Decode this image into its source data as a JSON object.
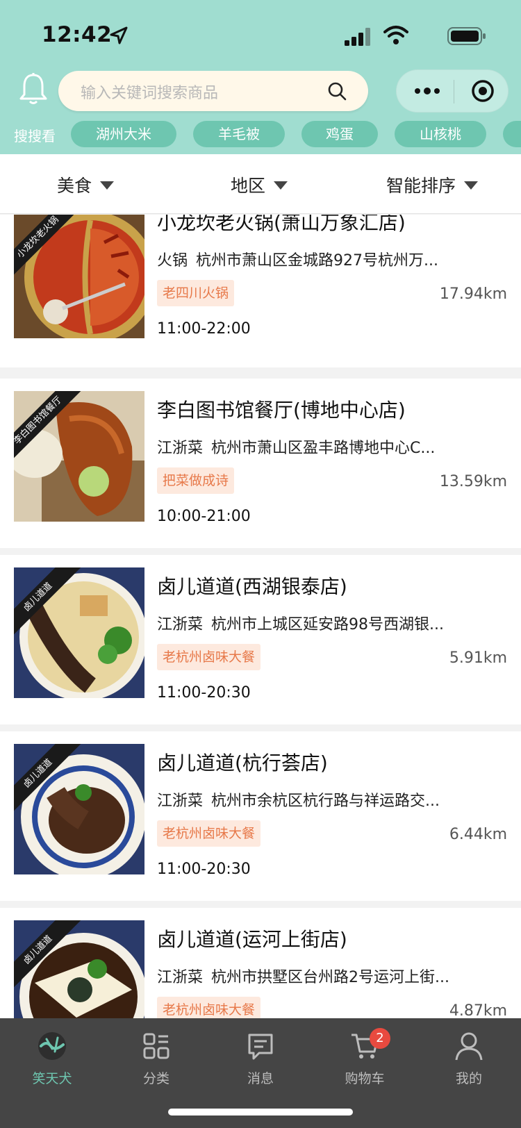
{
  "status_bar": {
    "time": "12:42"
  },
  "search": {
    "placeholder": "输入关键词搜索商品"
  },
  "hot_search": {
    "label": "搜搜看",
    "tags": [
      "湖州大米",
      "羊毛被",
      "鸡蛋",
      "山核桃"
    ]
  },
  "filters": [
    "美食",
    "地区",
    "智能排序"
  ],
  "restaurants": [
    {
      "name": "小龙坎老火锅(萧山万象汇店)",
      "category": "火锅",
      "address": "杭州市萧山区金城路927号杭州万...",
      "badge": "老四川火锅",
      "distance": "17.94km",
      "hours": "11:00-22:00",
      "image_label": "小龙坎老火锅"
    },
    {
      "name": "李白图书馆餐厅(博地中心店)",
      "category": "江浙菜",
      "address": "杭州市萧山区盈丰路博地中心C...",
      "badge": "把菜做成诗",
      "distance": "13.59km",
      "hours": "10:00-21:00",
      "image_label": "李白图书馆餐厅"
    },
    {
      "name": "卤儿道道(西湖银泰店)",
      "category": "江浙菜",
      "address": "杭州市上城区延安路98号西湖银...",
      "badge": "老杭州卤味大餐",
      "distance": "5.91km",
      "hours": "11:00-20:30",
      "image_label": "卤儿道道"
    },
    {
      "name": "卤儿道道(杭行荟店)",
      "category": "江浙菜",
      "address": "杭州市余杭区杭行路与祥运路交...",
      "badge": "老杭州卤味大餐",
      "distance": "6.44km",
      "hours": "11:00-20:30",
      "image_label": "卤儿道道"
    },
    {
      "name": "卤儿道道(运河上街店)",
      "category": "江浙菜",
      "address": "杭州市拱墅区台州路2号运河上街...",
      "badge": "老杭州卤味大餐",
      "distance": "4.87km",
      "hours": "",
      "image_label": "卤儿道道"
    }
  ],
  "tabbar": [
    {
      "label": "笑天犬",
      "icon": "brand-icon",
      "active": true
    },
    {
      "label": "分类",
      "icon": "category-icon"
    },
    {
      "label": "消息",
      "icon": "message-icon"
    },
    {
      "label": "购物车",
      "icon": "cart-icon",
      "badge": "2"
    },
    {
      "label": "我的",
      "icon": "profile-icon"
    }
  ],
  "colors": {
    "header_bg": "#a0ddd0",
    "accent": "#6ec6b0",
    "badge_text": "#e7794a",
    "badge_bg": "#fde9de",
    "tabbar_bg": "#454545",
    "cart_badge": "#e84a3f"
  }
}
